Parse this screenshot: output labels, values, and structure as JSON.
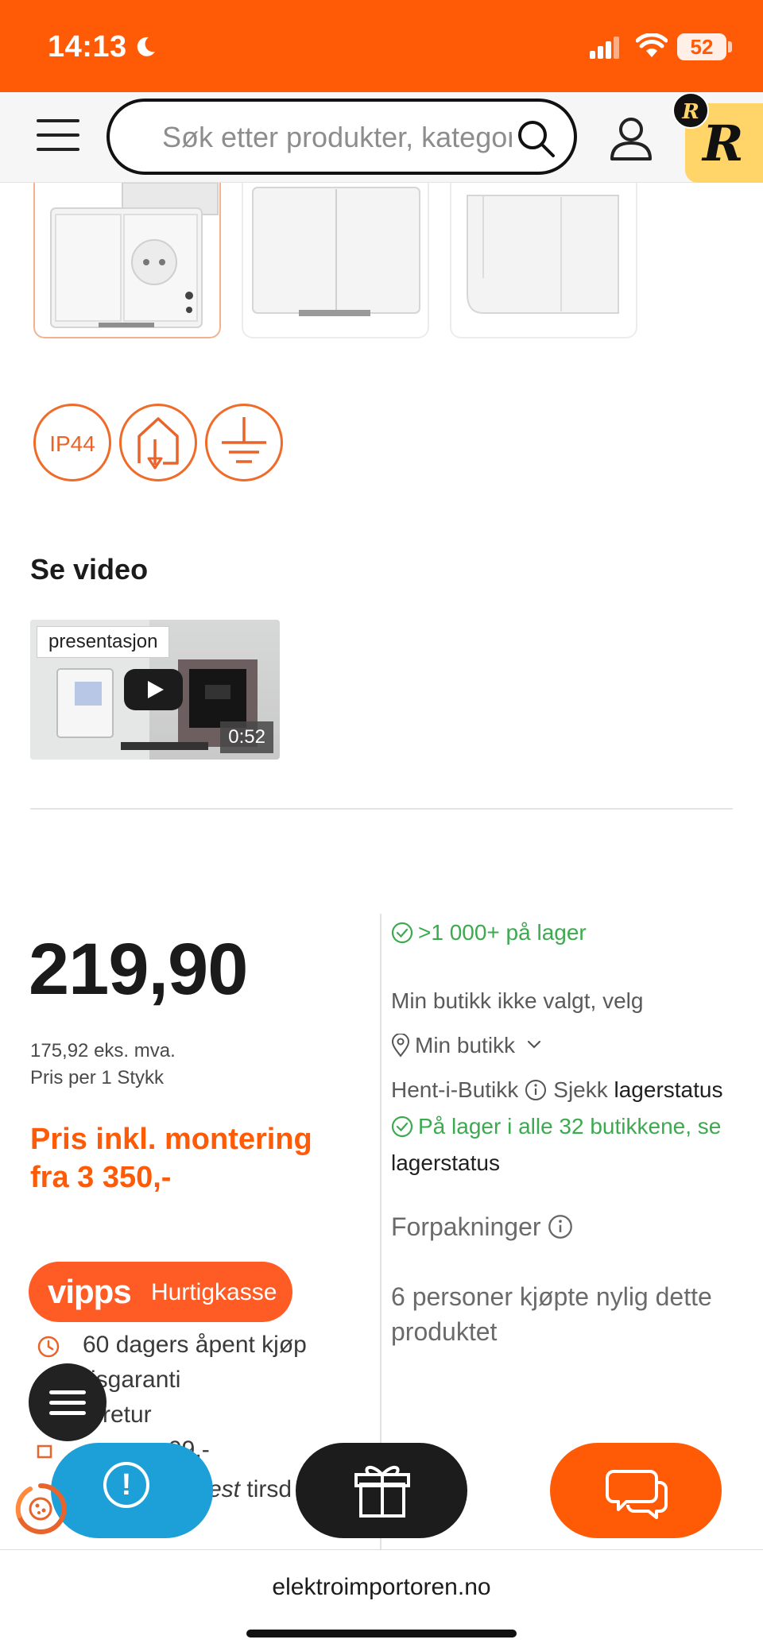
{
  "status_bar": {
    "time": "14:13",
    "battery": "52"
  },
  "header": {
    "search_placeholder": "Søk etter produkter, kategorier",
    "logo_letter": "R"
  },
  "badges": {
    "ip_rating": "IP44"
  },
  "video": {
    "heading": "Se video",
    "tag": "presentasjon",
    "duration": "0:52"
  },
  "price": {
    "amount": "219,90",
    "ex_vat": "175,92 eks. mva.",
    "per_unit": "Pris per 1 Stykk",
    "mount_line1": "Pris inkl. montering",
    "mount_line2": "fra 3 350,-"
  },
  "checkout": {
    "brand": "vipps",
    "label": "Hurtigkasse"
  },
  "perks": {
    "open_purchase": "60 dagers åpent kjøp",
    "price_guarantee": "risgaranti",
    "return": "ri retur",
    "shipping_price": "99,-",
    "delivery_partial": "est",
    "delivery_day_partial": "tirsd"
  },
  "stock": {
    "online": ">1 000+ på lager",
    "store_not_selected": "Min butikk ikke valgt, velg",
    "my_store": "Min butikk",
    "pickup": "Hent-i-Butikk",
    "check_prefix": "Sjekk",
    "check_link": "lagerstatus",
    "all_stores": "På lager i alle 32 butikkene, se",
    "all_stores_link": "lagerstatus",
    "packaging": "Forpakninger",
    "recent_buyers": "6 personer kjøpte nylig dette produktet"
  },
  "footer": {
    "url": "elektroimportoren.no"
  },
  "colors": {
    "brand_orange": "#ff5a06",
    "stock_green": "#3caa4f",
    "info_blue": "#1d9fd7",
    "logo_yellow": "#ffd56a"
  }
}
